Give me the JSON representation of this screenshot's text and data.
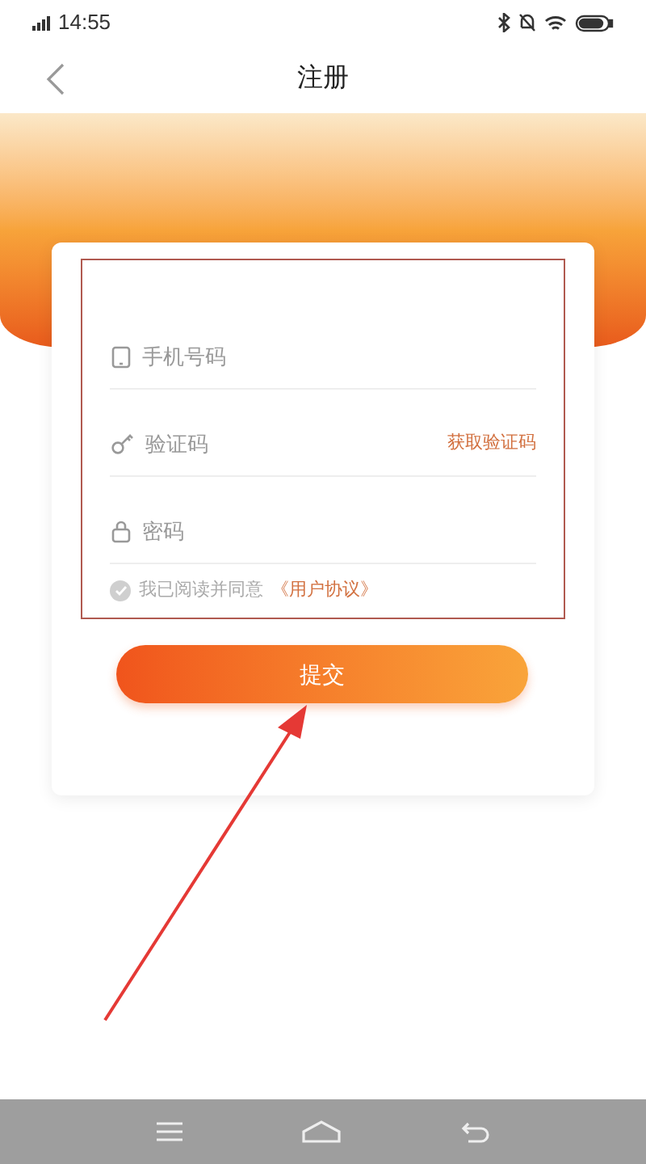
{
  "status_bar": {
    "time": "14:55"
  },
  "header": {
    "title": "注册"
  },
  "form": {
    "fields": [
      {
        "kind": "phone",
        "placeholder": "手机号码"
      },
      {
        "kind": "code",
        "placeholder": "验证码",
        "action": "获取验证码"
      },
      {
        "kind": "password",
        "placeholder": "密码"
      }
    ],
    "agreement": {
      "checked": false,
      "text": "我已阅读并同意",
      "link": "《用户协议》"
    },
    "submit": "提交"
  }
}
